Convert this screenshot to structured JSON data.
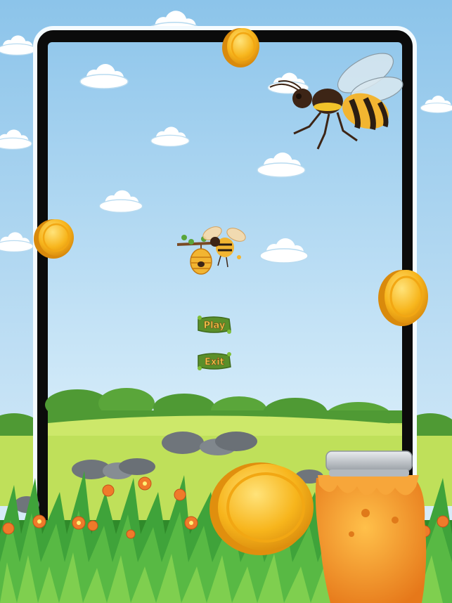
{
  "menu": {
    "play_label": "Play",
    "exit_label": "Exit"
  },
  "colors": {
    "sky_top": "#8cc4ea",
    "sky_bottom": "#e3f2fb",
    "frame": "#0b0b0b",
    "grass_field": "#bfe05a",
    "button_wood": "#5a8f2a",
    "button_text": "#f6c64a",
    "coin": "#f7b51c",
    "honey": "#f39a2a"
  },
  "icons": {
    "big_bee": "bee-icon",
    "logo": "bee-hive-logo-icon",
    "coin": "gold-coin-icon",
    "jar": "honey-jar-icon"
  }
}
